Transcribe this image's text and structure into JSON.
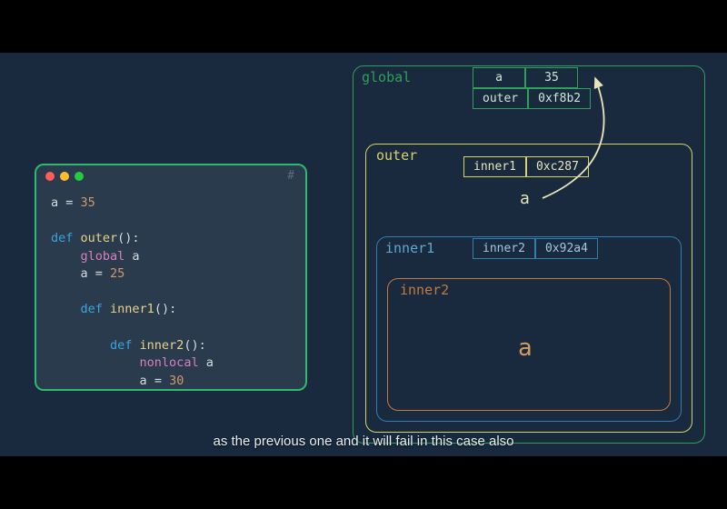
{
  "code": {
    "a_line": {
      "var": "a",
      "op": " = ",
      "val": "35"
    },
    "def_outer": {
      "kw": "def ",
      "name": "outer",
      "par": "():"
    },
    "global_a": {
      "kw": "global ",
      "var": "a"
    },
    "a25": {
      "var": "a",
      "op": " = ",
      "val": "25"
    },
    "def_inner1": {
      "kw": "def ",
      "name": "inner1",
      "par": "():"
    },
    "def_inner2": {
      "kw": "def ",
      "name": "inner2",
      "par": "():"
    },
    "nonlocal_a": {
      "kw": "nonlocal ",
      "var": "a"
    },
    "a30": {
      "var": "a",
      "op": " = ",
      "val": "30"
    }
  },
  "hash": "#",
  "scopes": {
    "global": "global",
    "outer": "outer",
    "inner1": "inner1",
    "inner2": "inner2"
  },
  "tables": {
    "global": [
      {
        "k": "a",
        "v": "35"
      },
      {
        "k": "outer",
        "v": "0xf8b2"
      }
    ],
    "outer": [
      {
        "k": "inner1",
        "v": "0xc287"
      }
    ],
    "inner1": [
      {
        "k": "inner2",
        "v": "0x92a4"
      }
    ]
  },
  "arrow_a_outer": "a",
  "big_a_inner2": "a",
  "caption": "as the previous one and it will fail in this case also"
}
